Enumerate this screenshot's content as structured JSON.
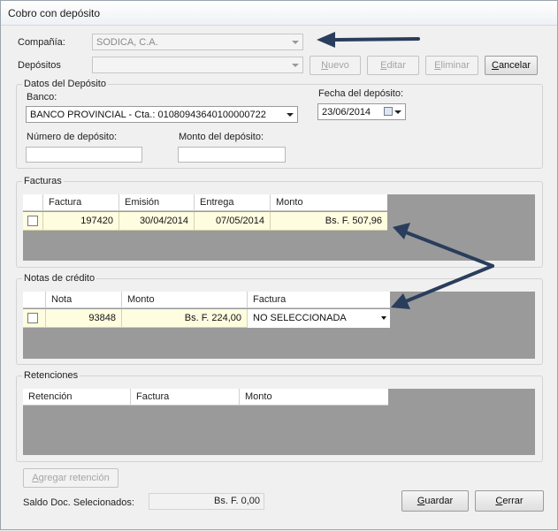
{
  "window": {
    "title": "Cobro con depósito"
  },
  "company": {
    "label": "Compañía:",
    "value": "SODICA, C.A."
  },
  "deposits": {
    "label": "Depósitos",
    "value": "",
    "buttons": {
      "new": {
        "u": "N",
        "rest": "uevo"
      },
      "edit": {
        "u": "E",
        "rest": "ditar"
      },
      "delete": {
        "u": "E",
        "rest": "liminar"
      },
      "cancel": {
        "u": "C",
        "rest": "ancelar"
      }
    }
  },
  "deposit_data": {
    "title": "Datos del Depósito",
    "bank_label": "Banco:",
    "bank_value": "BANCO PROVINCIAL - Cta.: 01080943640100000722",
    "date_label": "Fecha del depósito:",
    "date_value": "23/06/2014",
    "number_label": "Número de depósito:",
    "number_value": "",
    "amount_label": "Monto del depósito:",
    "amount_value": ""
  },
  "invoices": {
    "title": "Facturas",
    "columns": [
      "Factura",
      "Emisión",
      "Entrega",
      "Monto"
    ],
    "rows": [
      {
        "invoice": "197420",
        "issued": "30/04/2014",
        "delivered": "07/05/2014",
        "amount": "Bs. F. 507,96"
      }
    ]
  },
  "credit_notes": {
    "title": "Notas de crédito",
    "columns": [
      "Nota",
      "Monto",
      "Factura"
    ],
    "rows": [
      {
        "note": "93848",
        "amount": "Bs. F. 224,00",
        "invoice": "NO SELECCIONADA"
      }
    ]
  },
  "retentions": {
    "title": "Retenciones",
    "columns": [
      "Retención",
      "Factura",
      "Monto"
    ]
  },
  "footer": {
    "add_retention": {
      "u": "A",
      "rest": "gregar retención"
    },
    "balance_label": "Saldo Doc. Selecionados:",
    "balance_value": "Bs. F. 0,00",
    "save": {
      "u": "G",
      "rest": "uardar"
    },
    "close": {
      "u": "C",
      "rest": "errar"
    }
  },
  "colors": {
    "arrow": "#2a3d5c",
    "grid_bg": "#9a9a9a",
    "row_highlight": "#fffde0"
  }
}
